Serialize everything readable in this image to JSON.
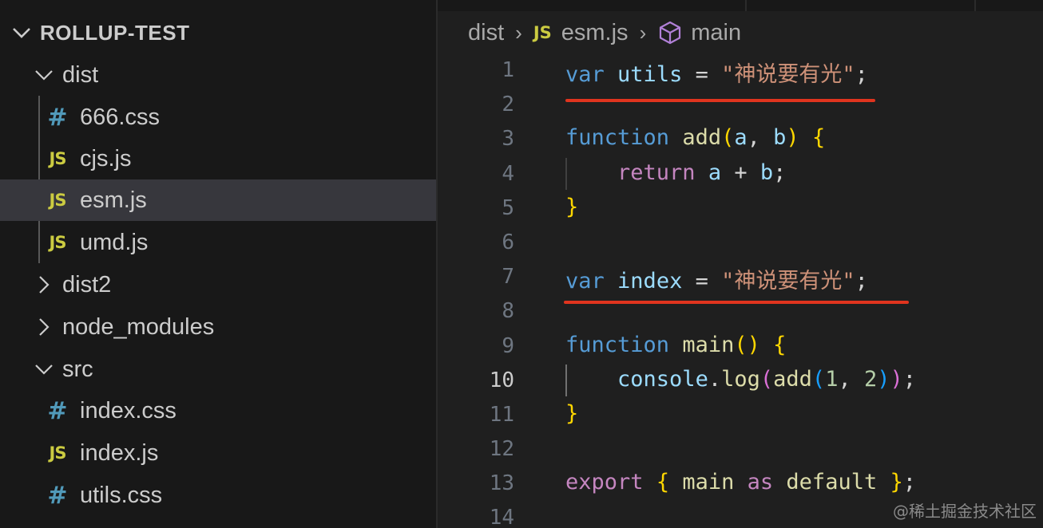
{
  "explorer": {
    "root_label": "ROLLUP-TEST",
    "items": [
      {
        "label": "dist",
        "kind": "folder",
        "expanded": true
      },
      {
        "label": "666.css",
        "kind": "file",
        "icon": "hash-icon"
      },
      {
        "label": "cjs.js",
        "kind": "file",
        "icon": "js-icon"
      },
      {
        "label": "esm.js",
        "kind": "file",
        "icon": "js-icon",
        "selected": true
      },
      {
        "label": "umd.js",
        "kind": "file",
        "icon": "js-icon"
      },
      {
        "label": "dist2",
        "kind": "folder",
        "expanded": false
      },
      {
        "label": "node_modules",
        "kind": "folder",
        "expanded": false
      },
      {
        "label": "src",
        "kind": "folder",
        "expanded": true
      },
      {
        "label": "index.css",
        "kind": "file",
        "icon": "hash-icon"
      },
      {
        "label": "index.js",
        "kind": "file",
        "icon": "js-icon"
      },
      {
        "label": "utils.css",
        "kind": "file",
        "icon": "hash-icon"
      }
    ],
    "js_badge": "JS",
    "hash_badge": "#"
  },
  "breadcrumb": {
    "folder": "dist",
    "file_badge": "JS",
    "file": "esm.js",
    "symbol": "main",
    "separator": "›"
  },
  "editor": {
    "current_line": 10,
    "line_numbers": [
      "1",
      "2",
      "3",
      "4",
      "5",
      "6",
      "7",
      "8",
      "9",
      "10",
      "11",
      "12",
      "13",
      "14"
    ],
    "code": {
      "l1": {
        "kw": "var",
        "name": "utils",
        "eq": " = ",
        "str": "\"神说要有光\"",
        "semi": ";"
      },
      "l3": {
        "kw": "function",
        "name": "add",
        "open": "(",
        "a": "a",
        "comma": ", ",
        "b": "b",
        "close": ")",
        "brace": "{"
      },
      "l4": {
        "kw": "return",
        "a": "a",
        "op": " + ",
        "b": "b",
        "semi": ";"
      },
      "l5": {
        "brace": "}"
      },
      "l7": {
        "kw": "var",
        "name": "index",
        "eq": " = ",
        "str": "\"神说要有光\"",
        "semi": ";"
      },
      "l9": {
        "kw": "function",
        "name": "main",
        "parens": "()",
        "brace": "{"
      },
      "l10": {
        "obj": "console",
        "dot": ".",
        "method": "log",
        "p1": "(",
        "fn": "add",
        "p2": "(",
        "n1": "1",
        "comma": ", ",
        "n2": "2",
        "p3": ")",
        "p4": ")",
        "semi": ";"
      },
      "l11": {
        "brace": "}"
      },
      "l13": {
        "kw": "export",
        "open": "{",
        "name": "main",
        "as": "as",
        "def": "default",
        "close": "}",
        "semi": ";"
      }
    }
  },
  "colors": {
    "annotation_underline": "#e0341e",
    "js_icon": "#cbcb41",
    "css_icon": "#519aba"
  },
  "watermark": "@稀土掘金技术社区"
}
